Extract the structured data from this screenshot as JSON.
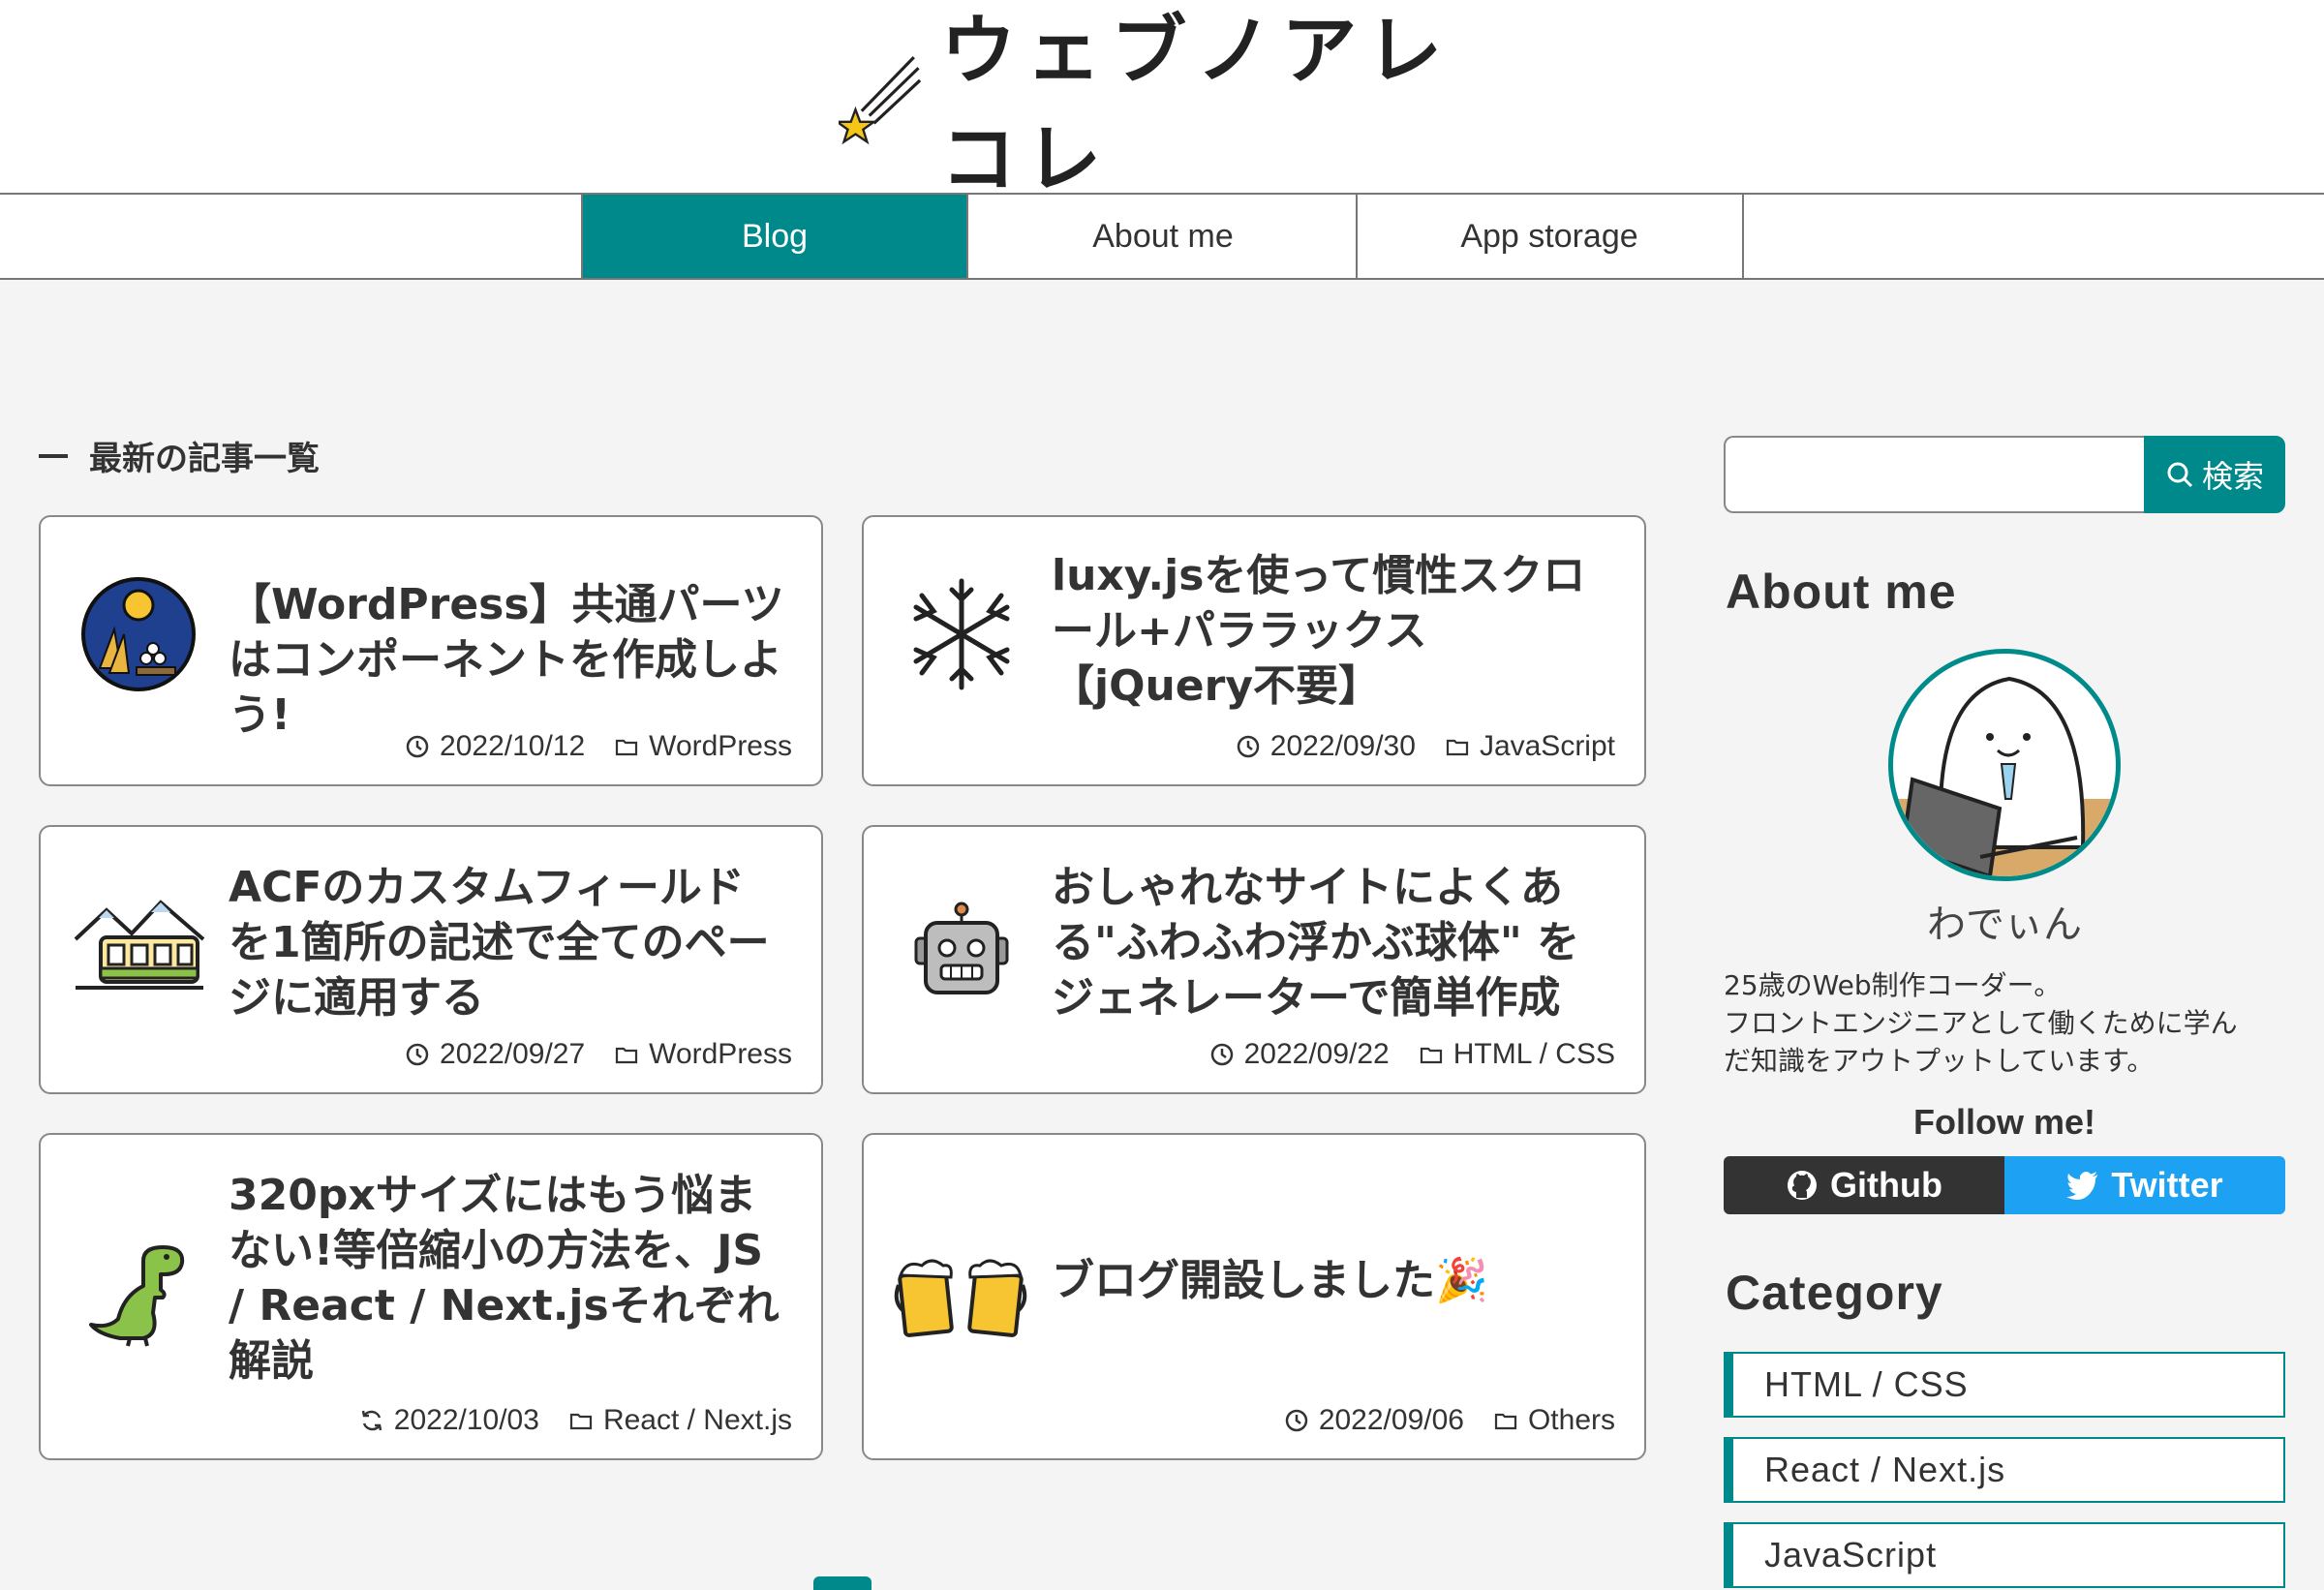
{
  "site": {
    "logo_text": "ウェブノアレコレ"
  },
  "nav": {
    "items": [
      {
        "label": "Blog",
        "active": true
      },
      {
        "label": "About me",
        "active": false
      },
      {
        "label": "App storage",
        "active": false
      }
    ]
  },
  "main": {
    "section_title": "最新の記事一覧",
    "posts": [
      {
        "title": "【WordPress】共通パーツはコンポーネントを作成しよう!",
        "icon": "moon-viewing-icon",
        "date_icon": "clock-icon",
        "date": "2022/10/12",
        "category": "WordPress"
      },
      {
        "title": "luxy.jsを使って慣性スクロール+パララックス【jQuery不要】",
        "icon": "snowflake-icon",
        "date_icon": "clock-icon",
        "date": "2022/09/30",
        "category": "JavaScript"
      },
      {
        "title": "ACFのカスタムフィールドを1箇所の記述で全てのページに適用する",
        "icon": "mountain-railway-icon",
        "date_icon": "clock-icon",
        "date": "2022/09/27",
        "category": "WordPress"
      },
      {
        "title": "おしゃれなサイトによくある\"ふわふわ浮かぶ球体\" をジェネレーターで簡単作成",
        "icon": "robot-icon",
        "date_icon": "clock-icon",
        "date": "2022/09/22",
        "category": "HTML / CSS"
      },
      {
        "title": "320pxサイズにはもう悩まない!等倍縮小の方法を、JS / React / Next.jsそれぞれ解説",
        "icon": "t-rex-icon",
        "date_icon": "refresh-icon",
        "date": "2022/10/03",
        "category": "React / Next.js"
      },
      {
        "title": "ブログ開設しました🎉",
        "icon": "beer-mugs-icon",
        "date_icon": "clock-icon",
        "date": "2022/09/06",
        "category": "Others"
      }
    ]
  },
  "sidebar": {
    "search": {
      "value": "",
      "placeholder": "",
      "button_label": "検索"
    },
    "about_title": "About me",
    "author_name": "わでぃん",
    "bio": [
      "25歳のWeb制作コーダー。",
      "フロントエンジニアとして働くために学ん",
      "だ知識をアウトプットしています。"
    ],
    "follow_label": "Follow me!",
    "social": [
      {
        "label": "Github",
        "icon": "github-icon",
        "color": "#333333"
      },
      {
        "label": "Twitter",
        "icon": "twitter-icon",
        "color": "#1da1f2"
      }
    ],
    "category_title": "Category",
    "categories": [
      "HTML / CSS",
      "React / Next.js",
      "JavaScript"
    ]
  },
  "colors": {
    "accent": "#00898a",
    "background": "#f4f4f4"
  }
}
